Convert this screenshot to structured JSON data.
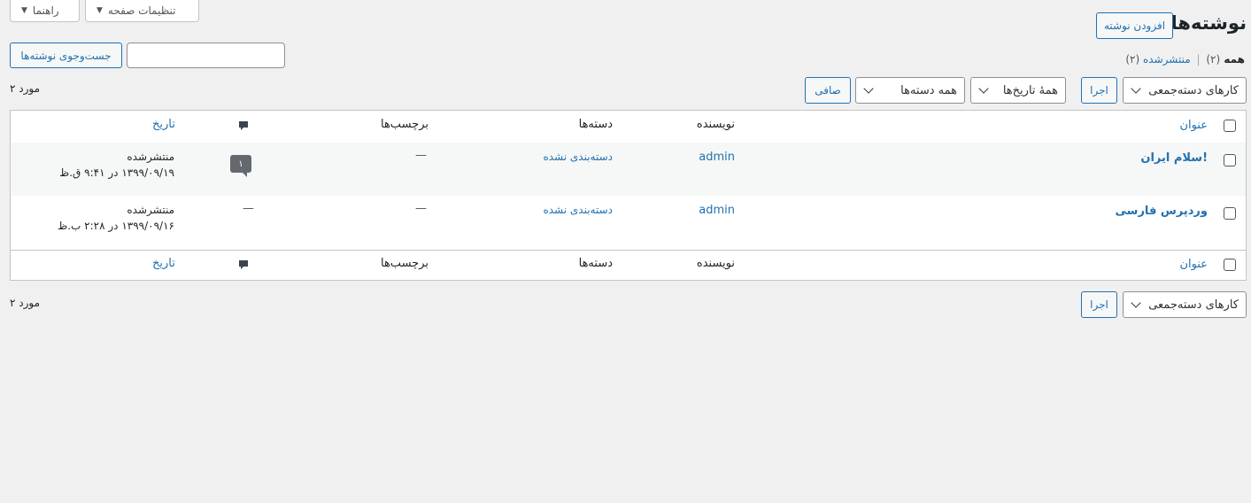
{
  "screen_meta": {
    "screen_options": "تنظیمات صفحه",
    "help": "راهنما"
  },
  "header": {
    "title": "نوشته‌ها",
    "add_new": "افزودن نوشته"
  },
  "subsubsub": {
    "all_label": "همه",
    "all_count": "(۲)",
    "separator": "|",
    "published_label": "منتشرشده",
    "published_count": "(۲)"
  },
  "search": {
    "value": "",
    "button": "جست‌وجوی نوشته‌ها"
  },
  "tablenav_top": {
    "bulk_actions": "کارهای دسته‌جمعی",
    "apply": "اجرا",
    "dates": "همهٔ تاریخ‌ها",
    "categories": "همه دسته‌ها",
    "filter": "صافی",
    "count": "۲ مورد"
  },
  "columns": {
    "title": "عنوان",
    "author": "نویسنده",
    "categories": "دسته‌ها",
    "tags": "برچسب‌ها",
    "date": "تاریخ"
  },
  "icons": {
    "comments": "comment-bubble-icon"
  },
  "posts": [
    {
      "title": "سلام ایران!",
      "author": "admin",
      "category": "دسته‌بندی نشده",
      "tags": "—",
      "comments": "۱",
      "status": "منتشرشده",
      "date": "۱۳۹۹/۰۹/۱۹ در ۹:۴۱ ق.ظ"
    },
    {
      "title": "وردپرس فارسی",
      "author": "admin",
      "category": "دسته‌بندی نشده",
      "tags": "—",
      "comments": "—",
      "status": "منتشرشده",
      "date": "۱۳۹۹/۰۹/۱۶ در ۲:۲۸ ب.ظ"
    }
  ],
  "tablenav_bottom": {
    "bulk_actions": "کارهای دسته‌جمعی",
    "apply": "اجرا",
    "count": "۲ مورد"
  },
  "colors": {
    "link": "#2271b1",
    "background": "#f0f0f1",
    "alt_row": "#f6f7f7"
  }
}
